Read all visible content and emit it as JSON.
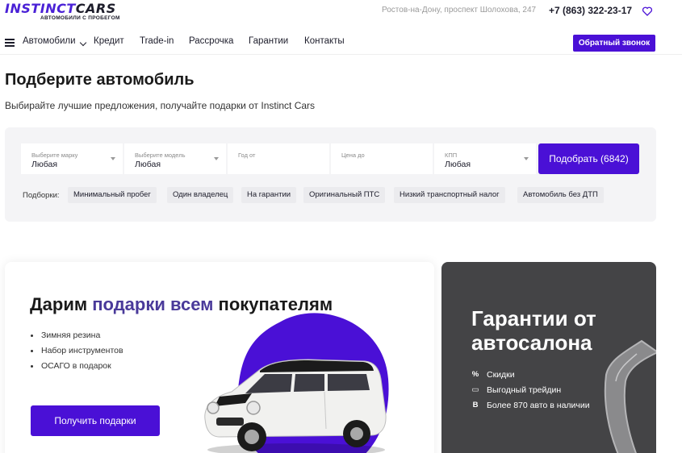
{
  "header": {
    "logo_part1": "INSTINCT",
    "logo_part2": "CARS",
    "logo_subtitle": "АВТОМОБИЛИ С ПРОБЕГОМ",
    "address": "Ростов-на-Дону, проспект Шолохова, 247",
    "phone": "+7 (863) 322-23-17",
    "favorite_icon": "heart-icon"
  },
  "nav": {
    "menu_icon": "burger-icon",
    "items": [
      {
        "label": "Автомобили"
      },
      {
        "label": "Кредит"
      },
      {
        "label": "Trade-in"
      },
      {
        "label": "Рассрочка"
      },
      {
        "label": "Гарантии"
      },
      {
        "label": "Контакты"
      }
    ],
    "callback_label": "Обратный звонок",
    "accent_color": "#4a10d6"
  },
  "hero": {
    "title": "Подберите автомобиль",
    "subtitle": "Выбирайте лучшие предложения, получайте подарки от Instinct Cars"
  },
  "filter": {
    "fields": [
      {
        "label": "Выберите марку",
        "value": "Любая"
      },
      {
        "label": "Выберите модель",
        "value": "Любая"
      },
      {
        "label": "Год от",
        "value": ""
      },
      {
        "label": "Цена до",
        "value": ""
      },
      {
        "label": "КПП",
        "value": "Любая"
      }
    ],
    "submit_label": "Подобрать (6842)",
    "tags_label": "Подборки:",
    "tags": [
      "Минимальный пробег",
      "Один владелец",
      "На гарантии",
      "Оригинальный ПТС",
      "Низкий транспортный налог",
      "Автомобиль без ДТП"
    ]
  },
  "promo": {
    "title_part1": "Дарим ",
    "title_accent": "подарки всем",
    "title_part2": " покупателям",
    "items": [
      "Зимняя резина",
      "Набор инструментов",
      "ОСАГО в подарок"
    ],
    "button_label": "Получить подарки",
    "blob_color": "#4a10d6"
  },
  "warranty": {
    "title": "Гарантии от автосалона",
    "items": [
      {
        "icon": "percent-icon",
        "glyph": "%",
        "label": "Скидки"
      },
      {
        "icon": "document-icon",
        "glyph": "▭",
        "label": "Выгодный трейдин"
      },
      {
        "icon": "b-letter-icon",
        "glyph": "B",
        "label": "Более 870 авто в наличии"
      }
    ],
    "background": "#444446"
  }
}
